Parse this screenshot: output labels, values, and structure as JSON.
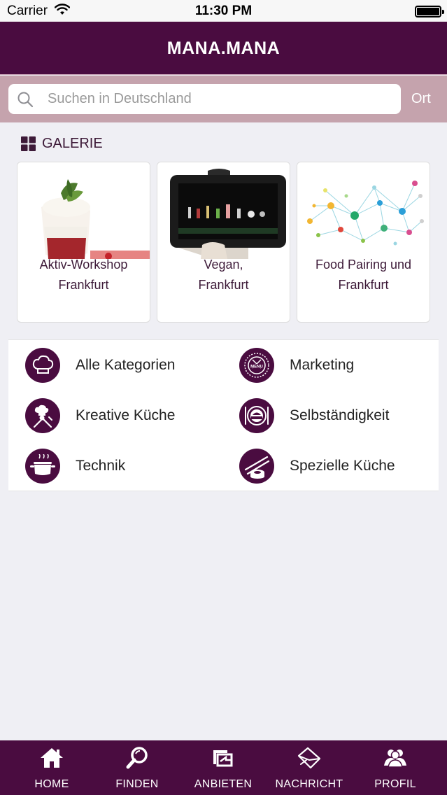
{
  "status_bar": {
    "carrier": "Carrier",
    "time": "11:30 PM"
  },
  "header": {
    "title": "MANA.MANA"
  },
  "search": {
    "placeholder": "Suchen in Deutschland",
    "location_label": "Ort"
  },
  "gallery": {
    "title": "GALERIE",
    "cards": [
      {
        "line1": "Aktiv-Workshop",
        "line2": "Frankfurt"
      },
      {
        "line1": "Vegan,",
        "line2": "Frankfurt"
      },
      {
        "line1": "Food Pairing und",
        "line2": "Frankfurt"
      }
    ]
  },
  "categories": [
    {
      "label": "Alle Kategorien",
      "icon": "chef-hat-icon"
    },
    {
      "label": "Marketing",
      "icon": "menu-badge-icon"
    },
    {
      "label": "Kreative Küche",
      "icon": "chef-cutlery-icon"
    },
    {
      "label": "Selbständigkeit",
      "icon": "restaurant-plate-icon"
    },
    {
      "label": "Technik",
      "icon": "cooking-pot-icon"
    },
    {
      "label": "Spezielle Küche",
      "icon": "sushi-chopsticks-icon"
    }
  ],
  "tabs": [
    {
      "label": "HOME",
      "icon": "home-icon"
    },
    {
      "label": "FINDEN",
      "icon": "search-icon"
    },
    {
      "label": "ANBIETEN",
      "icon": "offer-icon"
    },
    {
      "label": "NACHRICHT",
      "icon": "envelope-icon"
    },
    {
      "label": "PROFIL",
      "icon": "users-icon"
    }
  ],
  "colors": {
    "primary": "#4a0c40",
    "search_band": "#c5a3ad",
    "background": "#efeff4"
  }
}
